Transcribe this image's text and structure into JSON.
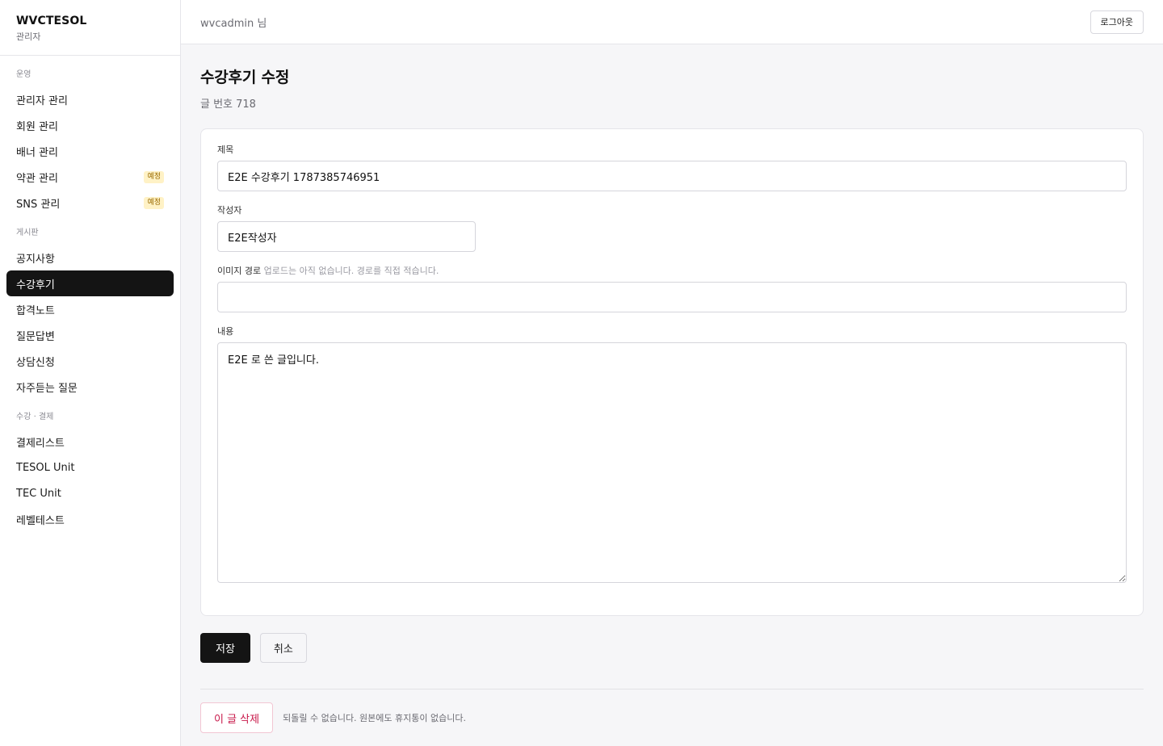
{
  "brand": {
    "name": "WVCTESOL",
    "sub": "관리자"
  },
  "topbar": {
    "user": "wvcadmin 님",
    "logout_label": "로그아웃"
  },
  "sidebar": {
    "groups": [
      {
        "label": "운영",
        "items": [
          {
            "label": "관리자 관리"
          },
          {
            "label": "회원 관리"
          },
          {
            "label": "배너 관리"
          },
          {
            "label": "약관 관리",
            "badge": "예정"
          },
          {
            "label": "SNS 관리",
            "badge": "예정"
          }
        ]
      },
      {
        "label": "게시판",
        "items": [
          {
            "label": "공지사항"
          },
          {
            "label": "수강후기",
            "active": true
          },
          {
            "label": "합격노트"
          },
          {
            "label": "질문답변"
          },
          {
            "label": "상담신청"
          },
          {
            "label": "자주듣는 질문"
          }
        ]
      },
      {
        "label": "수강 · 결제",
        "items": [
          {
            "label": "결제리스트"
          },
          {
            "label": "TESOL Unit"
          },
          {
            "label": "TEC Unit"
          },
          {
            "label": "레벨테스트"
          }
        ]
      }
    ]
  },
  "page": {
    "title": "수강후기 수정",
    "subtitle": "글 번호 718"
  },
  "form": {
    "title_label": "제목",
    "title_value": "E2E 수강후기 1787385746951",
    "author_label": "작성자",
    "author_value": "E2E작성자",
    "image_label": "이미지 경로",
    "image_hint": "업로드는 아직 없습니다. 경로를 직접 적습니다.",
    "image_value": "",
    "content_label": "내용",
    "content_value": "E2E 로 쓴 글입니다."
  },
  "actions": {
    "save_label": "저장",
    "cancel_label": "취소"
  },
  "danger": {
    "delete_label": "이 글 삭제",
    "note": "되돌릴 수 없습니다. 원본에도 휴지통이 없습니다."
  }
}
